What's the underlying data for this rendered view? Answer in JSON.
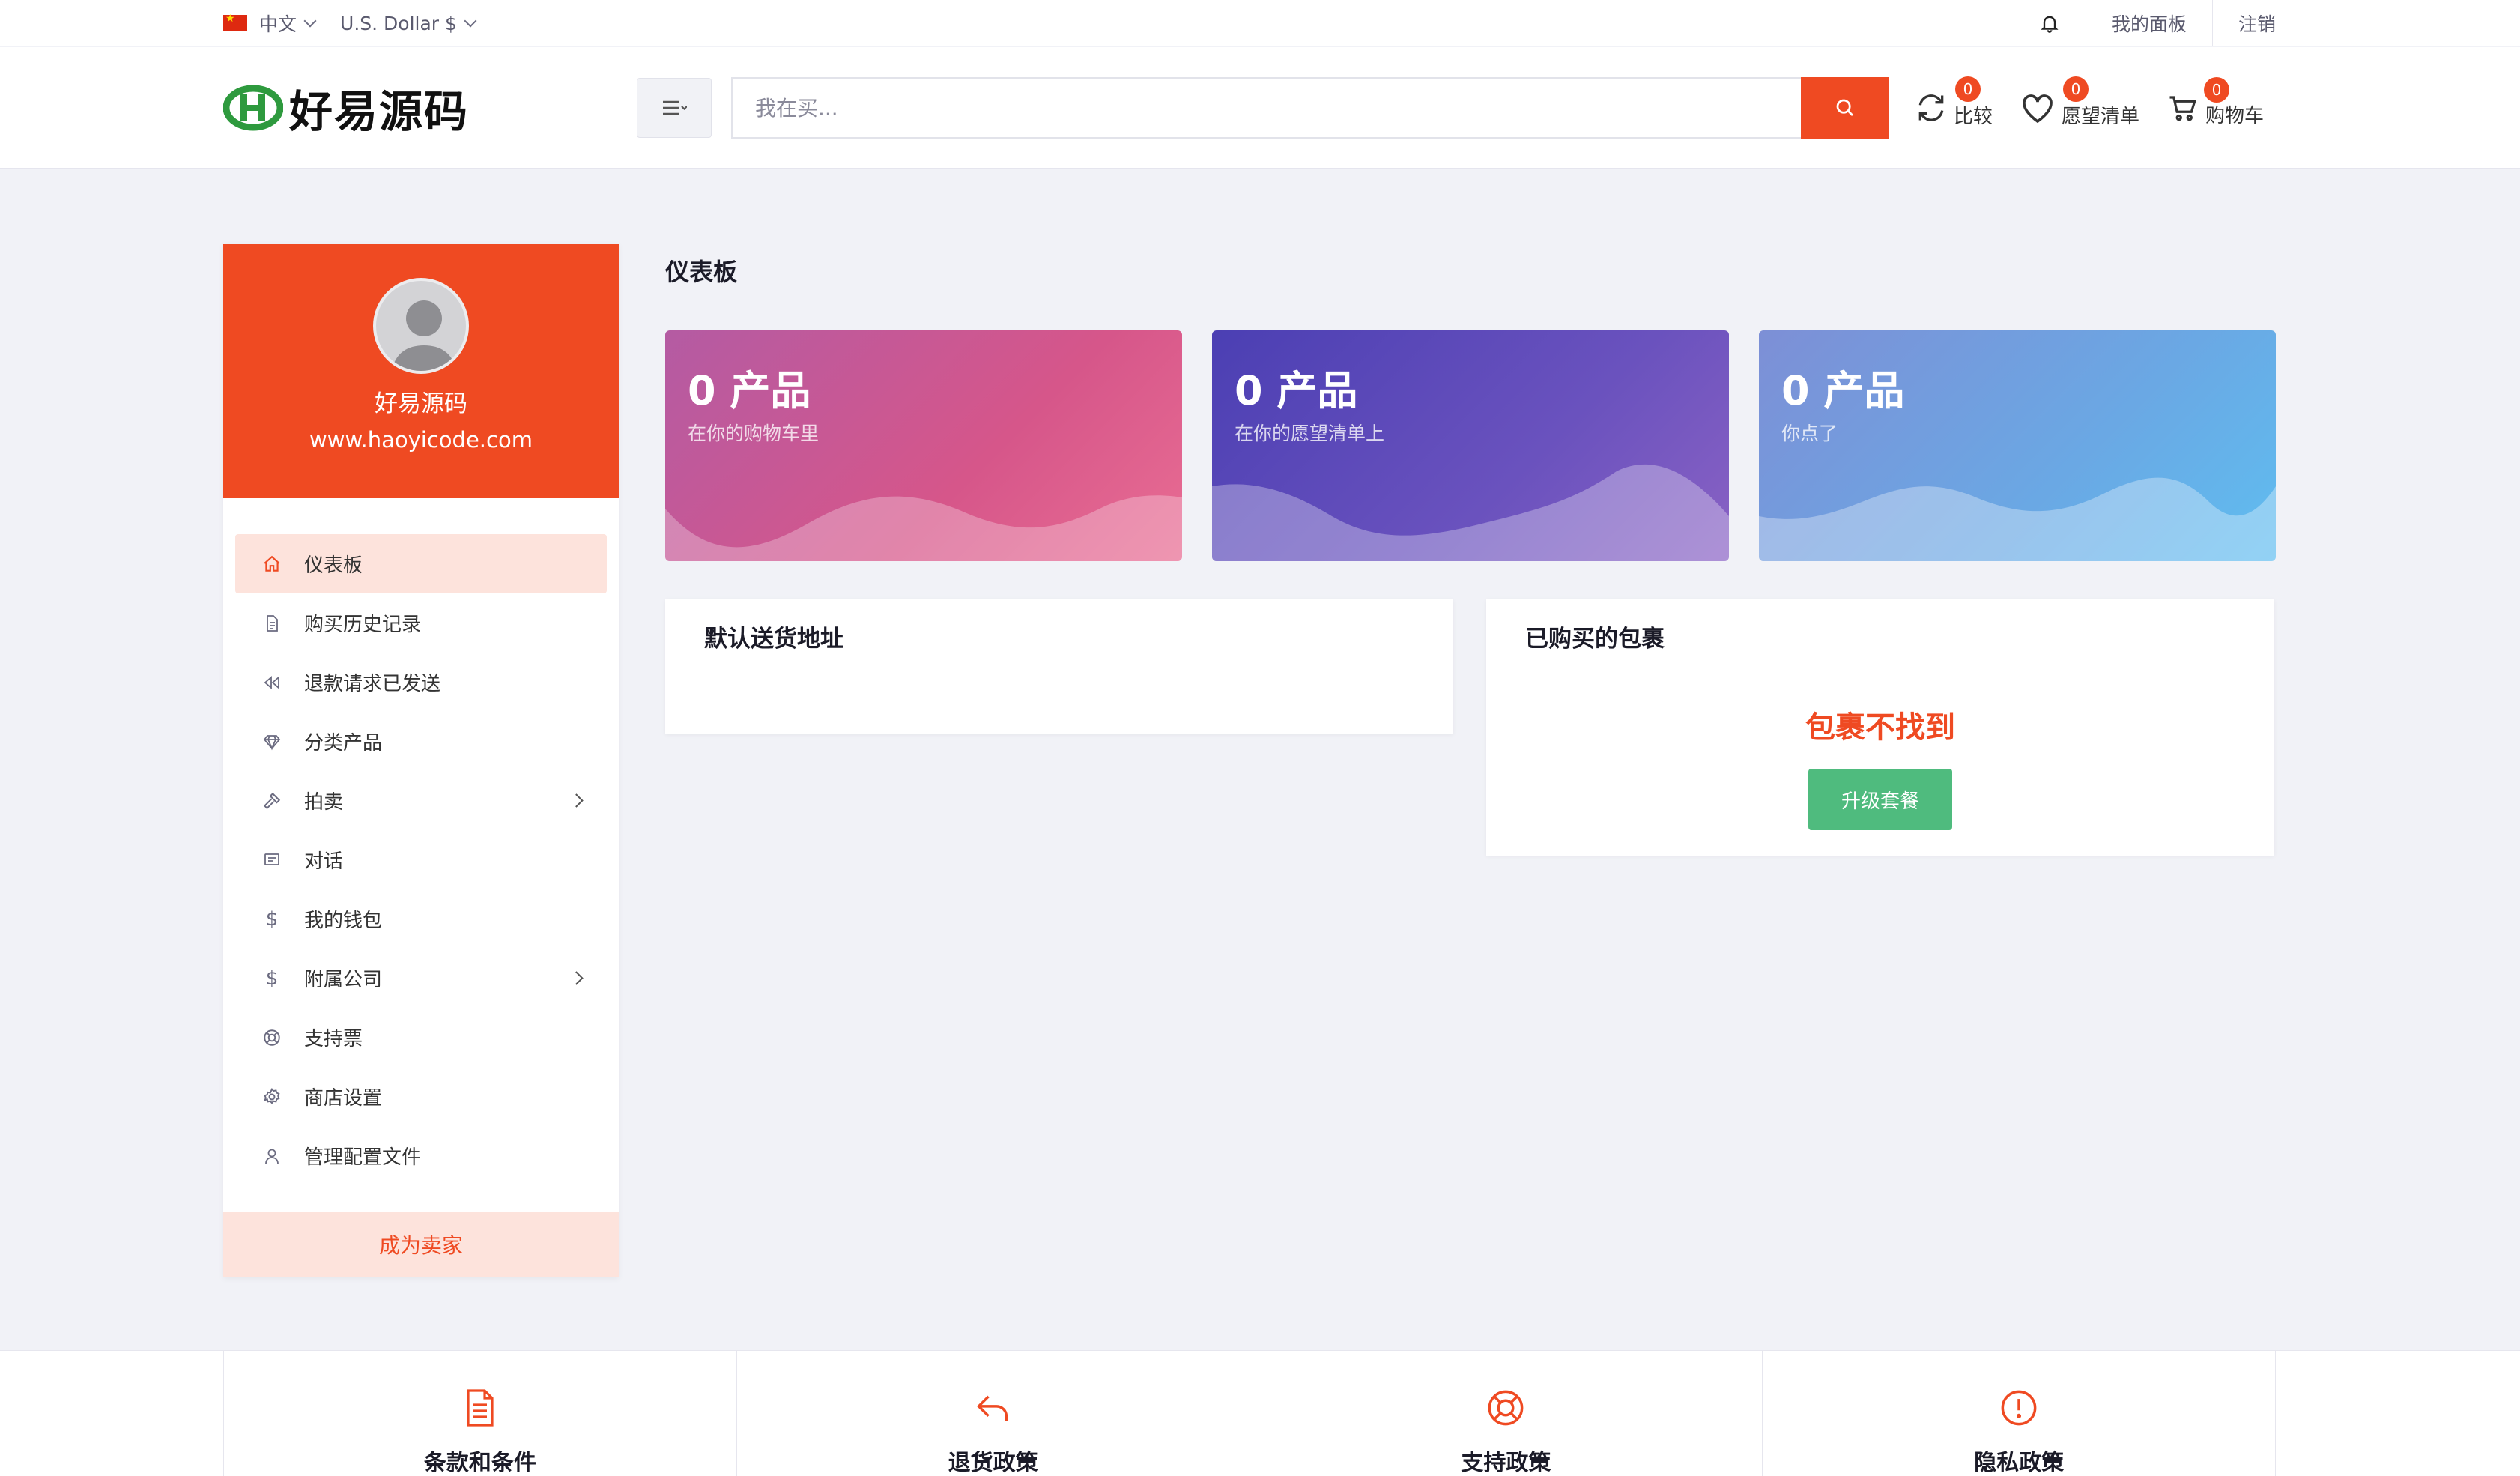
{
  "topbar": {
    "language": "中文",
    "currency": "U.S. Dollar $",
    "dashboard_link": "我的面板",
    "logout_link": "注销"
  },
  "header": {
    "logo_text": "好易源码",
    "search_placeholder": "我在买...",
    "compare": {
      "label": "比较",
      "count": "0"
    },
    "wishlist": {
      "label": "愿望清单",
      "count": "0"
    },
    "cart": {
      "label": "购物车",
      "count": "0"
    }
  },
  "sidebar": {
    "user_name": "好易源码",
    "user_site": "www.haoyicode.com",
    "items": [
      {
        "label": "仪表板",
        "icon": "home-icon",
        "active": true
      },
      {
        "label": "购买历史记录",
        "icon": "document-icon"
      },
      {
        "label": "退款请求已发送",
        "icon": "rewind-icon"
      },
      {
        "label": "分类产品",
        "icon": "diamond-icon"
      },
      {
        "label": "拍卖",
        "icon": "gavel-icon",
        "has_children": true
      },
      {
        "label": "对话",
        "icon": "chat-icon"
      },
      {
        "label": "我的钱包",
        "icon": "dollar-icon"
      },
      {
        "label": "附属公司",
        "icon": "dollar-icon",
        "has_children": true
      },
      {
        "label": "支持票",
        "icon": "support-icon"
      },
      {
        "label": "商店设置",
        "icon": "gear-icon"
      },
      {
        "label": "管理配置文件",
        "icon": "user-icon"
      }
    ],
    "become_seller": "成为卖家"
  },
  "main": {
    "title": "仪表板",
    "stats": [
      {
        "value": "0 产品",
        "caption": "在你的购物车里"
      },
      {
        "value": "0 产品",
        "caption": "在你的愿望清单上"
      },
      {
        "value": "0 产品",
        "caption": "你点了"
      }
    ],
    "address_card": {
      "title": "默认送货地址"
    },
    "package_card": {
      "title": "已购买的包裹",
      "not_found": "包裹不找到",
      "upgrade_button": "升级套餐"
    }
  },
  "footer": {
    "links": [
      {
        "label": "条款和条件",
        "icon": "document-icon"
      },
      {
        "label": "退货政策",
        "icon": "return-arrow-icon"
      },
      {
        "label": "支持政策",
        "icon": "lifebuoy-icon"
      },
      {
        "label": "隐私政策",
        "icon": "alert-icon"
      }
    ]
  },
  "colors": {
    "accent": "#ef4a22",
    "success": "#4fbb7e",
    "background": "#f1f2f7"
  }
}
